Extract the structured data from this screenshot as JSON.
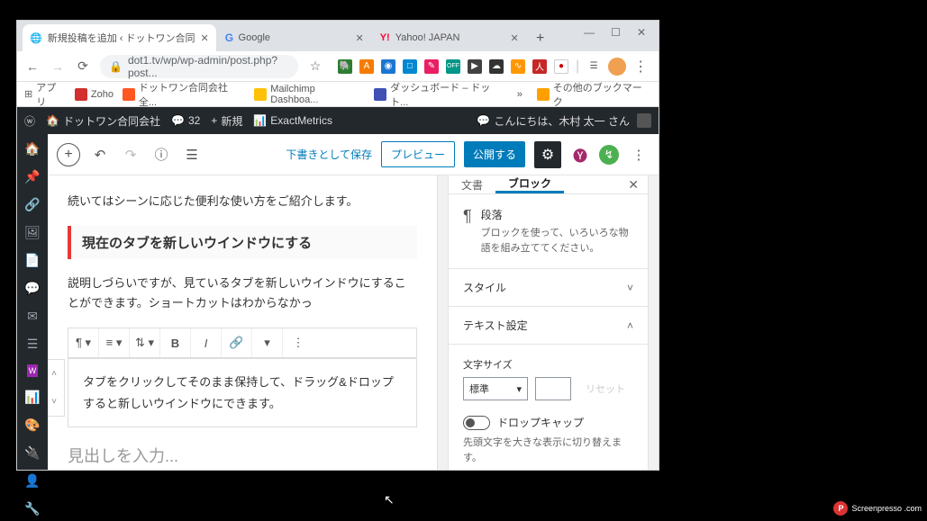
{
  "browser": {
    "tabs": [
      {
        "title": "新規投稿を追加 ‹ ドットワン合同",
        "favicon": "globe"
      },
      {
        "title": "Google",
        "favicon": "google"
      },
      {
        "title": "Yahoo! JAPAN",
        "favicon": "yahoo"
      }
    ],
    "url_lock": "dot1.tv/wp/wp-admin/post.php?post...",
    "bookmarks": {
      "apps": "アプリ",
      "items": [
        "Zoho",
        "ドットワン合同会社全...",
        "Mailchimp Dashboa...",
        "ダッシュボード – ドット..."
      ],
      "more": "»",
      "other": "その他のブックマーク"
    }
  },
  "wpbar": {
    "site": "ドットワン合同会社",
    "comments": "32",
    "new": "新規",
    "exact": "ExactMetrics",
    "greeting": "こんにちは、木村 太一 さん"
  },
  "editor": {
    "draft": "下書きとして保存",
    "preview": "プレビュー",
    "publish": "公開する",
    "para1": "続いてはシーンに応じた便利な使い方をご紹介します。",
    "heading": "現在のタブを新しいウインドウにする",
    "para2": "説明しづらいですが、見ているタブを新しいウインドウにすることができます。ショートカットはわからなかっ",
    "blockText": "タブをクリックしてそのまま保持して、ドラッグ&ドロップすると新しいウインドウにできます。",
    "placeholder": "見出しを入力..."
  },
  "sidebar": {
    "tab_doc": "文書",
    "tab_block": "ブロック",
    "blockType": "段落",
    "blockDesc": "ブロックを使って、いろいろな物語を組み立ててください。",
    "style": "スタイル",
    "textSettings": "テキスト設定",
    "fontSize": "文字サイズ",
    "fontSizeValue": "標準",
    "reset": "リセット",
    "dropcap": "ドロップキャップ",
    "dropcapHelp": "先頭文字を大きな表示に切り替えます。"
  },
  "watermark": "Screenpresso .com"
}
